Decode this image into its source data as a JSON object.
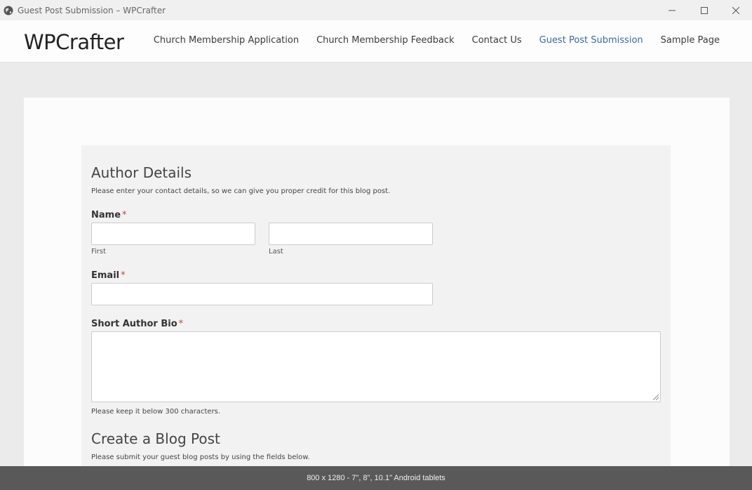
{
  "window": {
    "title": "Guest Post Submission – WPCrafter",
    "min_symbol": "—",
    "max_symbol": "☐",
    "close_symbol": "✕"
  },
  "header": {
    "logo": "WPCrafter",
    "nav": [
      {
        "label": "Church Membership Application",
        "active": false
      },
      {
        "label": "Church Membership Feedback",
        "active": false
      },
      {
        "label": "Contact Us",
        "active": false
      },
      {
        "label": "Guest Post Submission",
        "active": true
      },
      {
        "label": "Sample Page",
        "active": false
      }
    ]
  },
  "form": {
    "author_section": {
      "title": "Author Details",
      "description": "Please enter your contact details, so we can give you proper credit for this blog post."
    },
    "name": {
      "label": "Name",
      "required_mark": "*",
      "first_value": "",
      "first_sublabel": "First",
      "last_value": "",
      "last_sublabel": "Last"
    },
    "email": {
      "label": "Email",
      "required_mark": "*",
      "value": ""
    },
    "bio": {
      "label": "Short Author Bio",
      "required_mark": "*",
      "value": "",
      "hint": "Please keep it below 300 characters."
    },
    "post_section": {
      "title": "Create a Blog Post",
      "description": "Please submit your guest blog posts by using the fields below."
    }
  },
  "bottombar": {
    "text": "800 x 1280 - 7\", 8\", 10.1\" Android tablets"
  },
  "colors": {
    "accent_nav": "#3a6a9a",
    "required": "#c04545",
    "bottombar_bg": "#595959"
  }
}
